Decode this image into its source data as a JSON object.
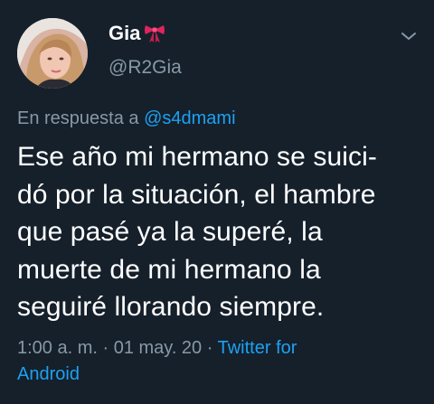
{
  "author": {
    "display_name": "Gia",
    "name_emoji_icon": "ribbon-bow-icon",
    "handle": "@R2Gia"
  },
  "reply": {
    "prefix": "En respuesta a ",
    "mention": "@s4dmami"
  },
  "tweet": {
    "lines": [
      "Ese año mi hermano se suici-",
      "dó por la situación, el hambre",
      "que pasé ya la superé, la",
      "muerte de mi hermano la",
      "seguiré llorando siempre."
    ]
  },
  "meta": {
    "time": "1:00 a. m.",
    "date": "01 may. 20",
    "separator": " · ",
    "source_line1": "Twitter for",
    "source_line2": "Android"
  },
  "colors": {
    "background": "#15202b",
    "text": "#ffffff",
    "secondary": "#8899a6",
    "accent": "#1da1f2",
    "bow": "#e0245e"
  }
}
